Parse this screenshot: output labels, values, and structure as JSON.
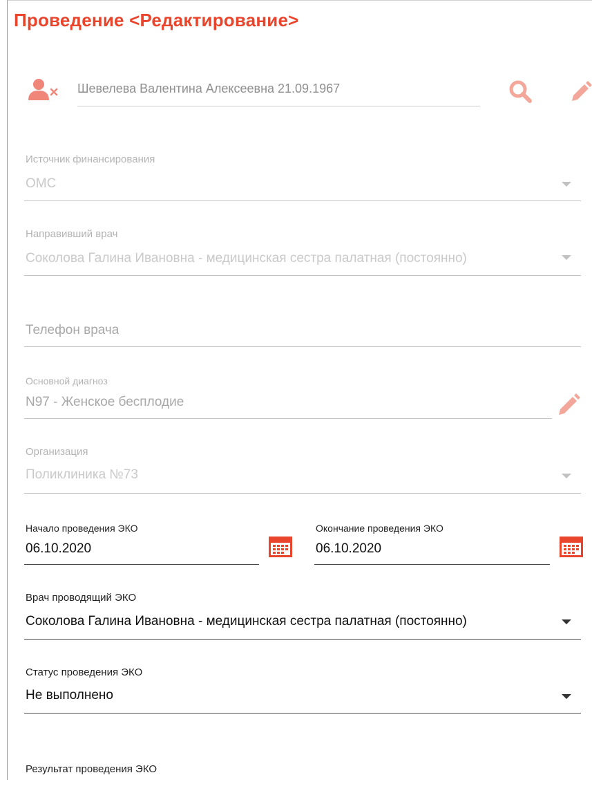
{
  "header": {
    "title": "Проведение <Редактирование>"
  },
  "patient": {
    "name": "Шевелева Валентина Алексеевна 21.09.1967"
  },
  "fields": {
    "funding": {
      "label": "Источник финансирования",
      "value": "ОМС"
    },
    "referring_doctor": {
      "label": "Направивший врач",
      "value": "Соколова Галина Ивановна - медицинская сестра палатная (постоянно)"
    },
    "doctor_phone": {
      "placeholder": "Телефон врача"
    },
    "diagnosis": {
      "label": "Основной диагноз",
      "value": "N97 - Женское бесплодие"
    },
    "organization": {
      "label": "Организация",
      "value": "Поликлиника №73"
    },
    "start_date": {
      "label": "Начало проведения ЭКО",
      "value": "06.10.2020"
    },
    "end_date": {
      "label": "Окончание проведения ЭКО",
      "value": "06.10.2020"
    },
    "eco_doctor": {
      "label": "Врач проводящий ЭКО",
      "value": "Соколова Галина Ивановна - медицинская сестра палатная (постоянно)"
    },
    "eco_status": {
      "label": "Статус проведения ЭКО",
      "value": "Не выполнено"
    },
    "eco_result": {
      "label": "Результат проведения ЭКО"
    }
  },
  "icons": {
    "patient_remove": "user-remove-icon",
    "search": "search-icon",
    "edit": "pencil-icon",
    "calendar": "calendar-icon",
    "dropdown": "chevron-down-icon"
  },
  "colors": {
    "accent": "#e8452c",
    "accent_light": "#f2a79a",
    "disabled_text": "#c9c9c9"
  }
}
